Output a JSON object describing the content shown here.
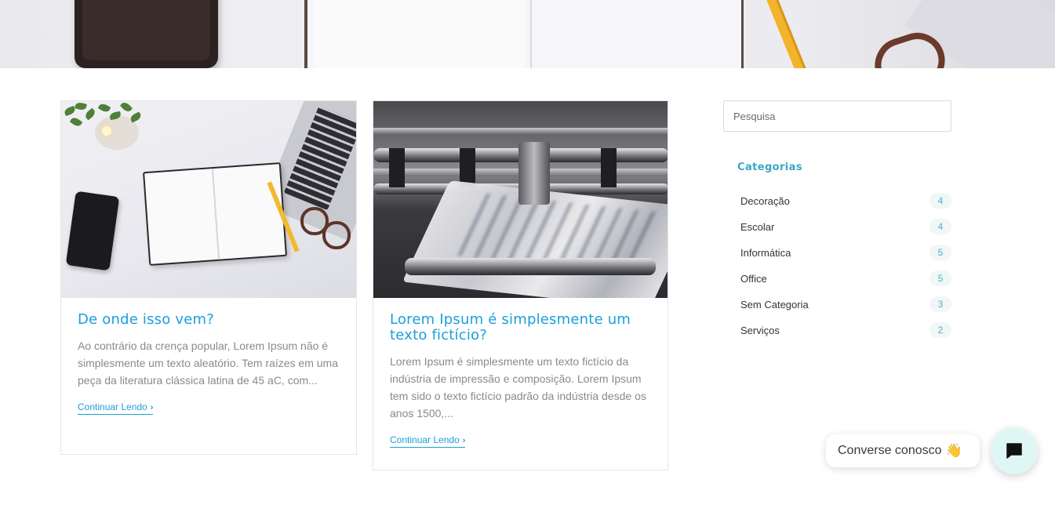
{
  "posts": [
    {
      "title": "De onde isso vem?",
      "excerpt": "Ao contrário da crença popular, Lorem Ipsum não é simplesmente um texto aleatório. Tem raízes em uma peça da literatura clássica latina de 45 aC, com...",
      "read_more": "Continuar Lendo"
    },
    {
      "title": "Lorem Ipsum é simplesmente um texto fictício?",
      "excerpt": "Lorem Ipsum é simplesmente um texto fictício da indústria de impressão e composição. Lorem Ipsum tem sido o texto fictício padrão da indústria desde os anos 1500,...",
      "read_more": "Continuar Lendo"
    }
  ],
  "sidebar": {
    "search": {
      "placeholder": "Pesquisa"
    },
    "categories_title": "Categorias",
    "categories": [
      {
        "label": "Decoração",
        "count": "4"
      },
      {
        "label": "Escolar",
        "count": "4"
      },
      {
        "label": "Informática",
        "count": "5"
      },
      {
        "label": "Office",
        "count": "5"
      },
      {
        "label": "Sem Categoria",
        "count": "3"
      },
      {
        "label": "Serviços",
        "count": "2"
      }
    ]
  },
  "chat": {
    "label": "Converse conosco",
    "emoji": "👋",
    "icon": "chat-icon"
  },
  "colors": {
    "accent": "#1a9fd9",
    "category_title": "#3aa6c7",
    "chat_button_bg": "#dff7f4"
  }
}
